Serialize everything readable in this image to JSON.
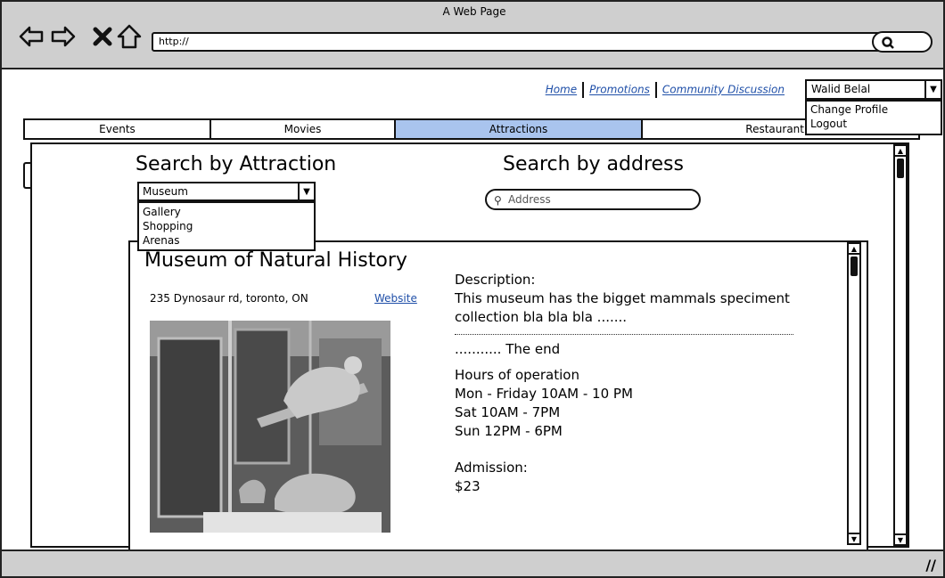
{
  "window": {
    "title": "A Web Page",
    "url": "http://"
  },
  "header": {
    "links": [
      {
        "label": "Home"
      },
      {
        "label": "Promotions"
      },
      {
        "label": "Community Discussion"
      }
    ],
    "user": {
      "name": "Walid Belal",
      "menu": [
        "Change Profile",
        "Logout"
      ]
    }
  },
  "tabs": [
    {
      "label": "Events",
      "active": false
    },
    {
      "label": "Movies",
      "active": false
    },
    {
      "label": "Attractions",
      "active": true
    },
    {
      "label": "Restaurant",
      "active": false
    }
  ],
  "search": {
    "attraction_heading": "Search by Attraction",
    "attraction_selected": "Museum",
    "attraction_options": [
      "Gallery",
      "Shopping",
      "Arenas"
    ],
    "address_heading": "Search by address",
    "address_placeholder": "Address"
  },
  "result": {
    "title": "Museum of Natural History",
    "address": "235 Dynosaur rd, toronto, ON",
    "website_label": "Website",
    "description_label": "Description:",
    "description": "This museum has the bigget mammals speciment collection bla bla bla .......",
    "description_end": "........... The end",
    "hours_label": "Hours of operation",
    "hours": [
      "Mon - Friday 10AM - 10 PM",
      "Sat 10AM - 7PM",
      "Sun 12PM - 6PM"
    ],
    "admission_label": "Admission:",
    "admission": "$23"
  },
  "colors": {
    "active_tab": "#a9c4ee",
    "link": "#1f4fa8",
    "chrome": "#cfcfcf"
  }
}
